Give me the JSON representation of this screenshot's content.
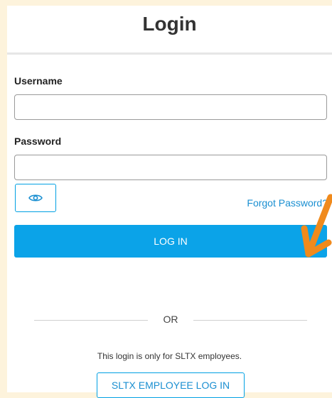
{
  "login": {
    "title": "Login",
    "username_label": "Username",
    "username_value": "",
    "password_label": "Password",
    "password_value": "",
    "show_password_icon": "eye-icon",
    "forgot_password": "Forgot Password?",
    "login_button": "LOG IN",
    "or_text": "OR",
    "employee_note": "This login is only for SLTX employees.",
    "employee_button": "SLTX EMPLOYEE LOG IN"
  },
  "annotation": {
    "icon": "orange-arrow",
    "color": "#f08a1c"
  },
  "colors": {
    "page_background": "#fdf3dc",
    "primary": "#0ba3e8",
    "link": "#1a8fd1"
  }
}
